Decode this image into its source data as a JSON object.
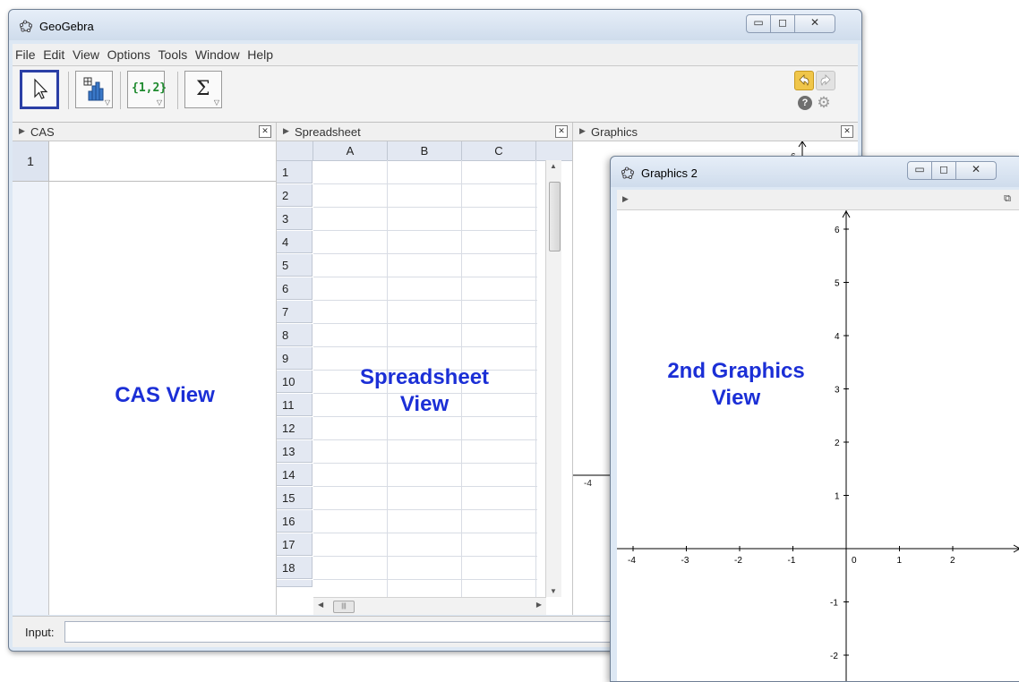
{
  "main_window": {
    "title": "GeoGebra",
    "icon": "geogebra-logo-icon",
    "controls": [
      "minimize-icon",
      "maximize-icon",
      "close-icon"
    ]
  },
  "menu": [
    "File",
    "Edit",
    "View",
    "Options",
    "Tools",
    "Window",
    "Help"
  ],
  "toolbar": {
    "tools": [
      {
        "name": "move-tool",
        "icon": "arrow-cursor-icon",
        "label": "",
        "selected": true
      },
      {
        "name": "chart-tool",
        "icon": "histogram-icon",
        "label": "",
        "selected": false
      },
      {
        "name": "list-tool",
        "icon": "list-icon",
        "label": "{1,2}",
        "selected": false
      },
      {
        "name": "sum-tool",
        "icon": "sigma-icon",
        "label": "Σ",
        "selected": false
      }
    ],
    "right_icons": [
      "undo-icon",
      "redo-icon",
      "help-icon",
      "settings-gear-icon"
    ]
  },
  "panels": {
    "cas": {
      "title": "CAS",
      "rows": [
        "1"
      ]
    },
    "spreadsheet": {
      "title": "Spreadsheet",
      "columns": [
        "A",
        "B",
        "C"
      ],
      "rows": [
        "1",
        "2",
        "3",
        "4",
        "5",
        "6",
        "7",
        "8",
        "9",
        "10",
        "11",
        "12",
        "13",
        "14",
        "15",
        "16",
        "17",
        "18"
      ]
    },
    "graphics": {
      "title": "Graphics",
      "y_tick_visible": "6",
      "x_tick_visible": "-4"
    }
  },
  "input_bar": {
    "label": "Input:",
    "value": ""
  },
  "overlays": {
    "cas": [
      "CAS View"
    ],
    "spreadsheet": [
      "Spreadsheet",
      "View"
    ],
    "graphics2": [
      "2nd Graphics",
      "View"
    ]
  },
  "graphics2_window": {
    "title": "Graphics 2",
    "controls": [
      "minimize-icon",
      "maximize-icon",
      "close-icon"
    ],
    "axes": {
      "x_ticks": [
        "-4",
        "-3",
        "-2",
        "-1",
        "0",
        "1",
        "2"
      ],
      "y_ticks": [
        "6",
        "5",
        "4",
        "3",
        "2",
        "1",
        "-1",
        "-2"
      ]
    }
  },
  "colors": {
    "overlay_text": "#1b2fd6",
    "tool_selected_border": "#2b3fa6",
    "undo": "#f0c64a"
  }
}
